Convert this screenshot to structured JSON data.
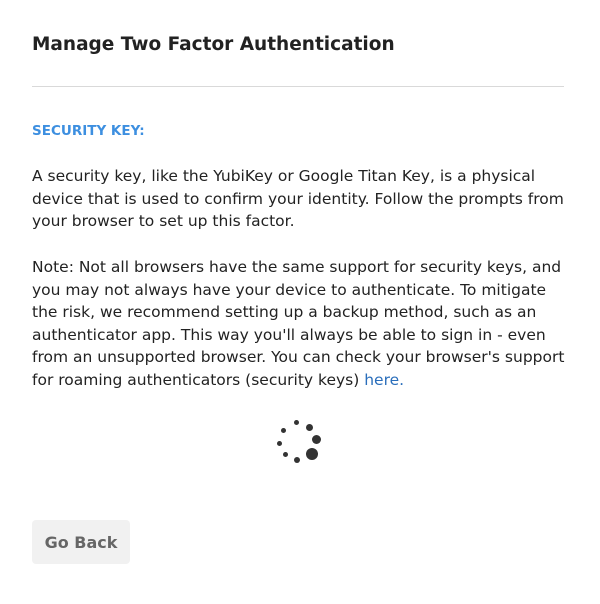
{
  "header": {
    "title": "Manage Two Factor Authentication"
  },
  "section": {
    "label": "SECURITY KEY:"
  },
  "content": {
    "intro": "A security key, like the YubiKey or Google Titan Key, is a physical device that is used to confirm your identity. Follow the prompts from your browser to set up this factor.",
    "note": "Note: Not all browsers have the same support for security keys, and you may not always have your device to authenticate. To mitigate the risk, we recommend setting up a backup method, such as an authenticator app. This way you'll always be able to sign in - even from an unsupported browser. You can check your browser's support for roaming authenticators (security keys) ",
    "note_link": "here."
  },
  "loading": {
    "icon": "loading-spinner-icon"
  },
  "actions": {
    "back_label": "Go Back"
  },
  "colors": {
    "accent": "#3d8fe0",
    "link": "#2a6ebb",
    "text": "#222222",
    "button_bg": "#f1f1f1",
    "button_text": "#666666"
  }
}
